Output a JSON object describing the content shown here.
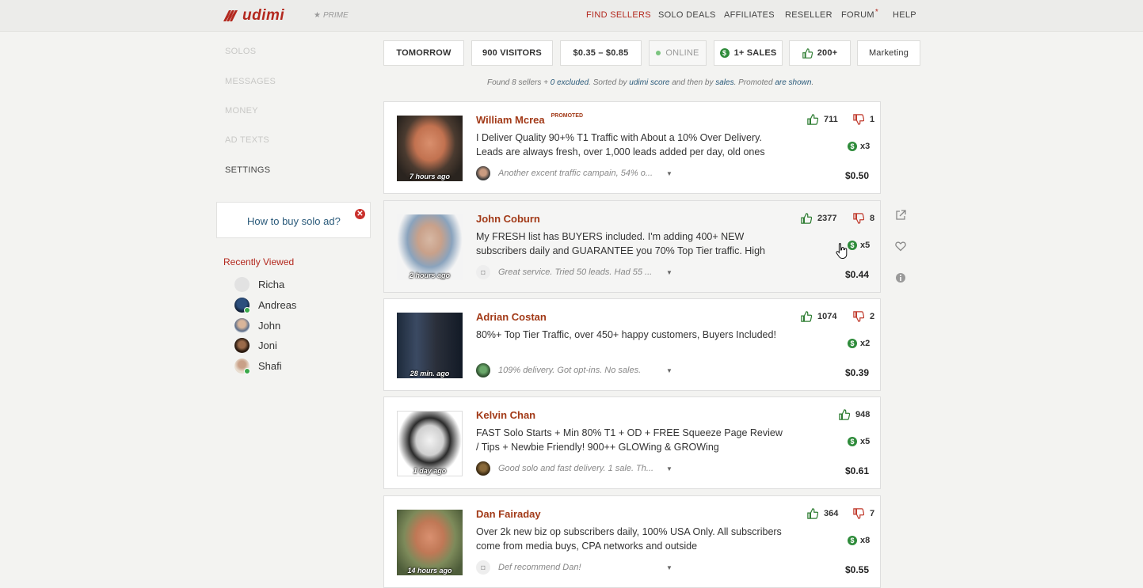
{
  "brand": {
    "logo_text": "udimi",
    "prime_label": "PRIME"
  },
  "nav": {
    "find_sellers": "FIND SELLERS",
    "solo_deals": "SOLO DEALS",
    "affiliates": "AFFILIATES",
    "reseller": "RESELLER",
    "forum": "FORUM",
    "forum_mark": "*",
    "help": "HELP"
  },
  "sidebar": {
    "solos": "SOLOS",
    "messages": "MESSAGES",
    "money": "MONEY",
    "ad_texts": "AD TEXTS",
    "settings": "SETTINGS",
    "how_to": "How to buy solo ad?",
    "close_glyph": "✕",
    "recent_title": "Recently Viewed",
    "recent": [
      {
        "name": "Richa",
        "online": false
      },
      {
        "name": "Andreas",
        "online": true
      },
      {
        "name": "John",
        "online": false
      },
      {
        "name": "Joni",
        "online": false
      },
      {
        "name": "Shafi",
        "online": true
      }
    ]
  },
  "filters": {
    "date": "TOMORROW",
    "visitors": "900 VISITORS",
    "price_range": "$0.35  –  $0.85",
    "online": "ONLINE",
    "sales": "1+ SALES",
    "likes": "200+",
    "niche": "Marketing"
  },
  "found": {
    "p1": "Found 8 sellers + ",
    "excluded": "0 excluded",
    "p2": ". Sorted by ",
    "score": "udimi score",
    "p3": " and then by ",
    "sales": "sales",
    "p4": ". Promoted ",
    "shown": "are shown",
    "p5": "."
  },
  "sellers": [
    {
      "name": "William Mcrea",
      "promoted": "PROMOTED",
      "ago": "7 hours ago",
      "desc": "I Deliver Quality 90+% T1 Traffic with About a 10% Over Delivery. Leads are always fresh, over 1,000 leads added per day, old ones",
      "review": "Another excent traffic campain, 54% o...",
      "likes": "711",
      "dislikes": "1",
      "sales": "x3",
      "price": "$0.50"
    },
    {
      "name": "John Coburn",
      "promoted": "",
      "ago": "2 hours ago",
      "desc": "My FRESH list has BUYERS included. I'm adding 400+ NEW subscribers daily and GUARANTEE you 70% Top Tier traffic. High",
      "review": "Great service. Tried 50 leads. Had 55 ...",
      "likes": "2377",
      "dislikes": "8",
      "sales": "x5",
      "price": "$0.44"
    },
    {
      "name": "Adrian Costan",
      "promoted": "",
      "ago": "28 min. ago",
      "desc": "80%+ Top Tier Traffic, over 450+ happy customers, Buyers Included!",
      "review": "109% delivery. Got opt-ins. No sales.",
      "likes": "1074",
      "dislikes": "2",
      "sales": "x2",
      "price": "$0.39"
    },
    {
      "name": "Kelvin Chan",
      "promoted": "",
      "ago": "1 day ago",
      "desc": "FAST Solo Starts + Min 80% T1 + OD + FREE Squeeze Page Review / Tips + Newbie Friendly! 900++ GLOWing & GROWing",
      "review": "Good solo and fast delivery. 1 sale. Th...",
      "likes": "948",
      "dislikes": "",
      "sales": "x5",
      "price": "$0.61"
    },
    {
      "name": "Dan Fairaday",
      "promoted": "",
      "ago": "14 hours ago",
      "desc": "Over 2k new biz op subscribers daily, 100% USA Only. All subscribers come from media buys, CPA networks and outside",
      "review": "Def recommend Dan!",
      "likes": "364",
      "dislikes": "7",
      "sales": "x8",
      "price": "$0.55"
    }
  ],
  "colors": {
    "accent": "#b3281e",
    "link": "#2a5a7a",
    "money_green": "#2e8b3a"
  }
}
